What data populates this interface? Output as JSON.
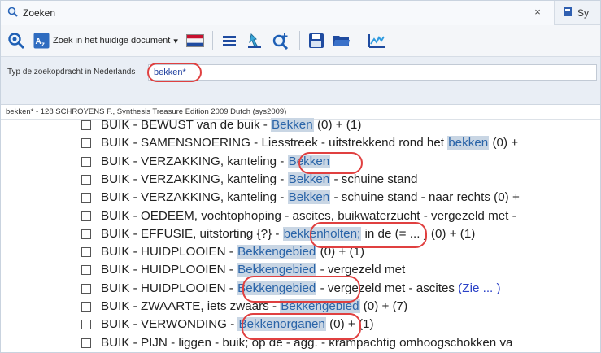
{
  "tabs": {
    "active_label": "Zoeken",
    "second_label": "Sy",
    "close_glyph": "×"
  },
  "toolbar": {
    "search_doc_label": "Zoek in het huidige document",
    "search_doc_dropdown": "▾"
  },
  "search": {
    "prompt": "Typ de zoekopdracht in Nederlands",
    "value": "bekken*"
  },
  "results": {
    "header": "bekken* - 128  SCHROYENS F., Synthesis Treasure Edition 2009 Dutch (sys2009)",
    "rows": [
      {
        "pre": "BUIK - BEWUST van de buik - ",
        "hit": "Bekken",
        "post": " (0)  + (1)",
        "ref": ""
      },
      {
        "pre": "BUIK - SAMENSNOERING - Liesstreek - uitstrekkend rond het ",
        "hit": "bekken",
        "post": " (0)  +",
        "ref": ""
      },
      {
        "pre": "BUIK - VERZAKKING, kanteling - ",
        "hit": "Bekken",
        "post": "",
        "ref": ""
      },
      {
        "pre": "BUIK - VERZAKKING, kanteling - ",
        "hit": "Bekken",
        "post": " - schuine stand",
        "ref": ""
      },
      {
        "pre": "BUIK - VERZAKKING, kanteling - ",
        "hit": "Bekken",
        "post": " - schuine stand - naar rechts (0)  +",
        "ref": ""
      },
      {
        "pre": "BUIK - OEDEEM, vochtophoping - ascites, buikwaterzucht - vergezeld met -",
        "hit": "",
        "post": "",
        "ref": ""
      },
      {
        "pre": "BUIK - EFFUSIE, uitstorting {?} - ",
        "hit": "bekkenholten;",
        "post": " in de (= ... ) (0)  + (1)",
        "ref": ""
      },
      {
        "pre": "BUIK - HUIDPLOOIEN - ",
        "hit": "Bekkengebied",
        "post": " (0)  + (1)",
        "ref": ""
      },
      {
        "pre": "BUIK - HUIDPLOOIEN - ",
        "hit": "Bekkengebied",
        "post": " - vergezeld met",
        "ref": ""
      },
      {
        "pre": "BUIK - HUIDPLOOIEN - ",
        "hit": "Bekkengebied",
        "post": " - vergezeld met - ascites ",
        "ref": "(Zie ... )"
      },
      {
        "pre": "BUIK - ZWAARTE, iets zwaars - ",
        "hit": "Bekkengebied",
        "post": " (0)  + (7)",
        "ref": ""
      },
      {
        "pre": "BUIK - VERWONDING - ",
        "hit": "Bekkenorganen",
        "post": " (0)  + (1)",
        "ref": ""
      },
      {
        "pre": "BUIK - PIJN - liggen - buik; op de - agg. - krampachtig omhoogschokken va",
        "hit": "",
        "post": "",
        "ref": ""
      }
    ]
  },
  "colors": {
    "accent_highlight": "#e04040",
    "hit_background": "#c9d6e4",
    "hit_text": "#2a64a8",
    "link": "#2a41c7"
  },
  "icons": [
    "search-icon",
    "az-icon",
    "dutch-flag-icon",
    "list-icon",
    "hand-pointer-icon",
    "zoom-add-icon",
    "save-icon",
    "folder-open-icon",
    "chart-icon",
    "book-icon"
  ]
}
